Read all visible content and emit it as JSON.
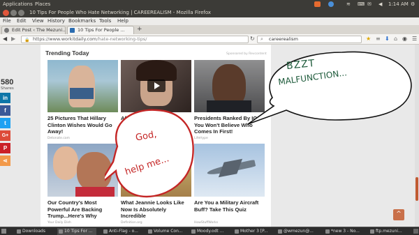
{
  "topbar": {
    "menu1": "Applications",
    "menu2": "Places",
    "time": "1:14 AM"
  },
  "window": {
    "title": "10 Tips For People Who Hate Networking | CAREEREALISM - Mozilla Firefox"
  },
  "menu": [
    "File",
    "Edit",
    "View",
    "History",
    "Bookmarks",
    "Tools",
    "Help"
  ],
  "tabs": [
    {
      "label": "Edit Post ‹ The Mezuni..."
    },
    {
      "label": "10 Tips For People ..."
    }
  ],
  "nav": {
    "url_host": "https://www.workitdaily.com",
    "url_path": "/hate-networking-tips/",
    "search_value": "careerealism"
  },
  "share": {
    "count": "580",
    "label": "Shares"
  },
  "page": {
    "heading": "Trending Today",
    "sponsored": "Sponsored by Revcontent",
    "cards": [
      {
        "caption": "25 Pictures That Hillary Clinton Wishes Would Go Away!",
        "source": "Detonate.com"
      },
      {
        "caption": "After Seeing This Sicili... What... Bu...",
        "source": ""
      },
      {
        "caption": "Presidents Ranked By IQ, You Won't Believe Who Comes In First!",
        "source": "LifeHype"
      },
      {
        "caption": "Our Country's Most Powerful Are Backing Trump...Here's Why",
        "source": "Your Daily Dish"
      },
      {
        "caption": "What Jeannie Looks Like Now Is Absolutely Incredible",
        "source": "Definition.org"
      },
      {
        "caption": "Are You a Military Aircraft Buff? Take This Quiz",
        "source": "HowStuffWorks"
      }
    ]
  },
  "bubbles": {
    "right": [
      "BZZT",
      "MALFUNCTION..."
    ],
    "left": [
      "God,",
      "help me..."
    ]
  },
  "taskbar": [
    "Downloads",
    "10 Tips For ...",
    "Anti-Flag - o...",
    "Volume Con...",
    "Moody.odt ...",
    "Mother 3 [P...",
    "@wmezun@...",
    "*new 3 - No...",
    "ftp.mezuni..."
  ]
}
